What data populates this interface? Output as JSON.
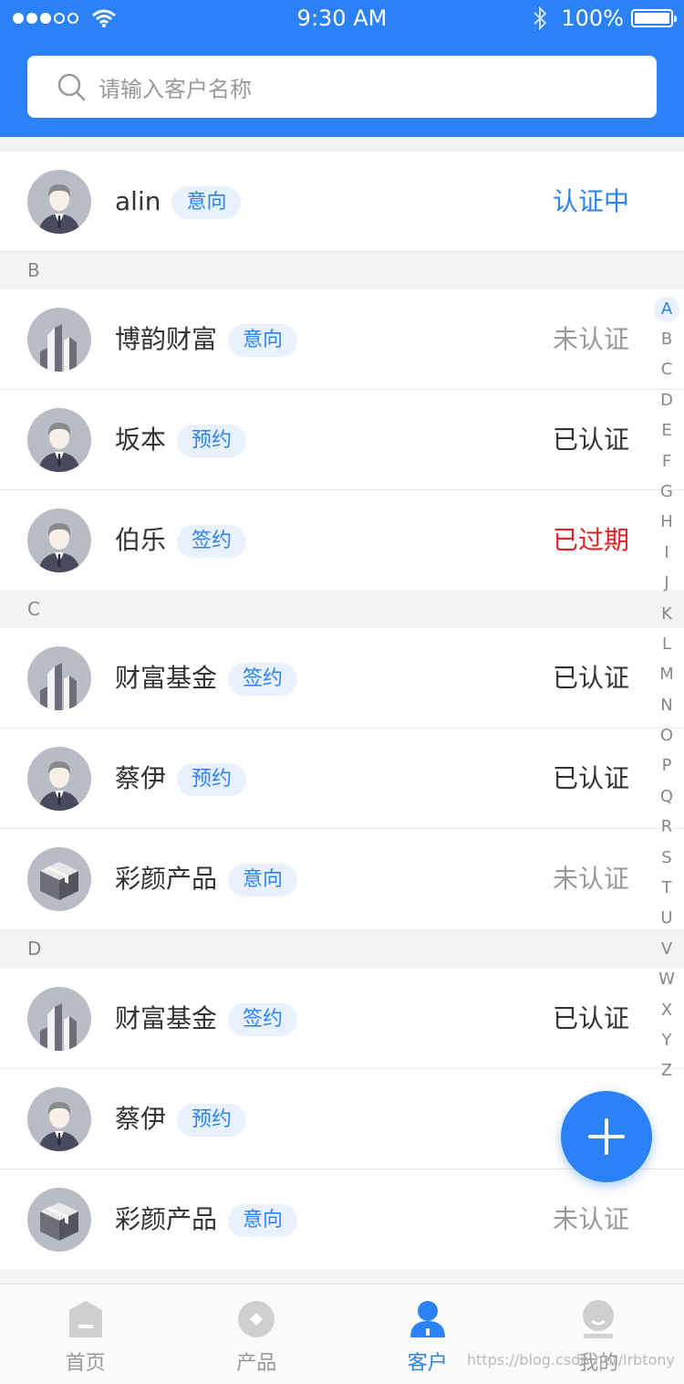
{
  "status_bar": {
    "time": "9:30 AM",
    "battery": "100%"
  },
  "search": {
    "placeholder": "请输入客户名称"
  },
  "groups": [
    {
      "letter": "",
      "rows": [
        {
          "name": "alin",
          "tag": "意向",
          "status": "认证中",
          "status_color": "#2a82f6",
          "avatar": "person-avatar"
        }
      ]
    },
    {
      "letter": "B",
      "rows": [
        {
          "name": "博韵财富",
          "tag": "意向",
          "status": "未认证",
          "status_color": "#999999",
          "avatar": "building-avatar"
        },
        {
          "name": "坂本",
          "tag": "预约",
          "status": "已认证",
          "status_color": "#333333",
          "avatar": "person-avatar"
        },
        {
          "name": "伯乐",
          "tag": "签约",
          "status": "已过期",
          "status_color": "#e62020",
          "avatar": "person-avatar"
        }
      ]
    },
    {
      "letter": "C",
      "rows": [
        {
          "name": "财富基金",
          "tag": "签约",
          "status": "已认证",
          "status_color": "#333333",
          "avatar": "building-avatar"
        },
        {
          "name": "蔡伊",
          "tag": "预约",
          "status": "已认证",
          "status_color": "#333333",
          "avatar": "person-avatar"
        },
        {
          "name": "彩颜产品",
          "tag": "意向",
          "status": "未认证",
          "status_color": "#999999",
          "avatar": "box-avatar"
        }
      ]
    },
    {
      "letter": "D",
      "rows": [
        {
          "name": "财富基金",
          "tag": "签约",
          "status": "已认证",
          "status_color": "#333333",
          "avatar": "building-avatar"
        },
        {
          "name": "蔡伊",
          "tag": "预约",
          "status": "已",
          "status_color": "#333333",
          "avatar": "person-avatar"
        },
        {
          "name": "彩颜产品",
          "tag": "意向",
          "status": "未认证",
          "status_color": "#999999",
          "avatar": "box-avatar"
        }
      ]
    }
  ],
  "index_letters": [
    "A",
    "B",
    "C",
    "D",
    "E",
    "F",
    "G",
    "H",
    "I",
    "J",
    "K",
    "L",
    "M",
    "N",
    "O",
    "P",
    "Q",
    "R",
    "S",
    "T",
    "U",
    "V",
    "W",
    "X",
    "Y",
    "Z"
  ],
  "index_active": "A",
  "tabs": [
    {
      "label": "首页",
      "icon": "home-icon",
      "active": false
    },
    {
      "label": "产品",
      "icon": "product-icon",
      "active": false
    },
    {
      "label": "客户",
      "icon": "customer-icon",
      "active": true
    },
    {
      "label": "我的",
      "icon": "profile-icon",
      "active": false
    }
  ],
  "watermark": "https://blog.csdn.net/lrbtony",
  "colors": {
    "primary": "#2a82f6",
    "tag_bg": "#e9f1fe",
    "expired": "#e62020"
  }
}
